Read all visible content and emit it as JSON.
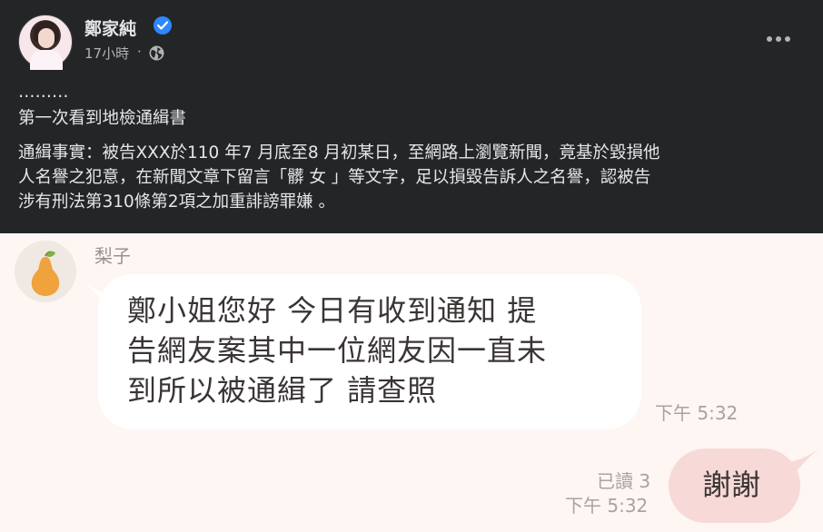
{
  "post": {
    "author": "鄭家純",
    "time": "17小時",
    "separator": "·",
    "ellipsis": "………",
    "title_line": "第一次看到地檢通緝書",
    "body": "通緝事實：被告XXX於110 年7 月底至8 月初某日，至網路上瀏覽新聞，竟基於毀損他\n人名譽之犯意，在新聞文章下留言「髒 女 」等文字，足以損毀告訴人之名譽，認被告\n涉有刑法第310條第2項之加重誹謗罪嫌 。",
    "icons": {
      "verified": "verified-badge-icon",
      "audience": "globe-icon",
      "menu": "more-options-icon"
    }
  },
  "chat": {
    "sender_name": "梨子",
    "incoming_message": "鄭小姐您好 今日有收到通知 提\n告網友案其中一位網友因一直未\n到所以被通緝了 請查照",
    "incoming_time": "下午 5:32",
    "read_status": "已讀 3",
    "outgoing_time": "下午 5:32",
    "outgoing_message": "謝謝",
    "icons": {
      "sender_avatar": "pear-icon"
    }
  },
  "colors": {
    "post_bg": "#242526",
    "post_text": "#e4e6eb",
    "chat_bg": "#fdf6f3",
    "incoming_bubble": "#ffffff",
    "outgoing_bubble": "#f7d9d7",
    "verified_blue": "#2d88ff"
  }
}
